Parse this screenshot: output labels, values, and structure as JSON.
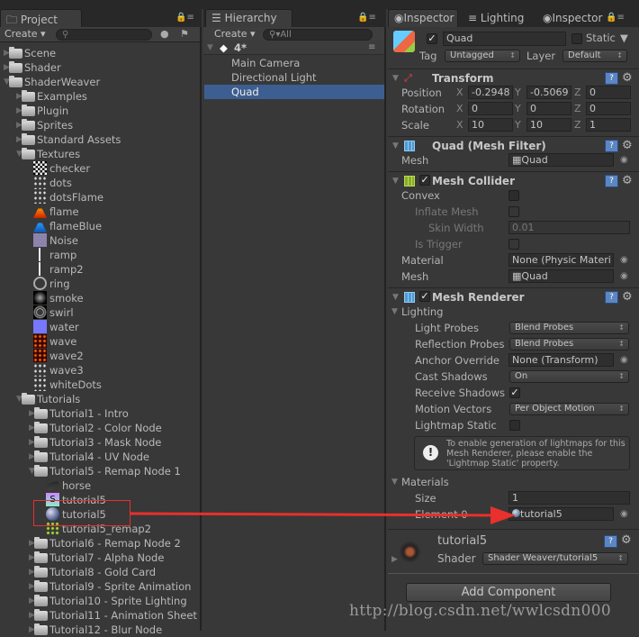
{
  "project": {
    "tab_label": "Project",
    "create_label": "Create",
    "search_placeholder": "",
    "tree": [
      {
        "label": "Scene",
        "depth": 0,
        "icon": "folder",
        "arrow": "collapsed"
      },
      {
        "label": "Shader",
        "depth": 0,
        "icon": "folder",
        "arrow": "collapsed"
      },
      {
        "label": "ShaderWeaver",
        "depth": 0,
        "icon": "folder",
        "arrow": "expanded"
      },
      {
        "label": "Examples",
        "depth": 1,
        "icon": "folder",
        "arrow": "collapsed"
      },
      {
        "label": "Plugin",
        "depth": 1,
        "icon": "folder",
        "arrow": "collapsed"
      },
      {
        "label": "Sprites",
        "depth": 1,
        "icon": "folder",
        "arrow": "collapsed"
      },
      {
        "label": "Standard Assets",
        "depth": 1,
        "icon": "folder",
        "arrow": "collapsed"
      },
      {
        "label": "Textures",
        "depth": 1,
        "icon": "folder",
        "arrow": "expanded"
      },
      {
        "label": "checker",
        "depth": 2,
        "icon": "texture-checker"
      },
      {
        "label": "dots",
        "depth": 2,
        "icon": "texture-dots"
      },
      {
        "label": "dotsFlame",
        "depth": 2,
        "icon": "texture-dots"
      },
      {
        "label": "flame",
        "depth": 2,
        "icon": "texture-flame"
      },
      {
        "label": "flameBlue",
        "depth": 2,
        "icon": "texture-flameblue"
      },
      {
        "label": "Noise",
        "depth": 2,
        "icon": "texture-noise"
      },
      {
        "label": "ramp",
        "depth": 2,
        "icon": "texture-ramp"
      },
      {
        "label": "ramp2",
        "depth": 2,
        "icon": "texture-ramp"
      },
      {
        "label": "ring",
        "depth": 2,
        "icon": "texture-ring"
      },
      {
        "label": "smoke",
        "depth": 2,
        "icon": "texture-smoke"
      },
      {
        "label": "swirl",
        "depth": 2,
        "icon": "texture-swirl"
      },
      {
        "label": "water",
        "depth": 2,
        "icon": "texture-water"
      },
      {
        "label": "wave",
        "depth": 2,
        "icon": "texture-wave"
      },
      {
        "label": "wave2",
        "depth": 2,
        "icon": "texture-wave"
      },
      {
        "label": "wave3",
        "depth": 2,
        "icon": "texture-dots"
      },
      {
        "label": "whiteDots",
        "depth": 2,
        "icon": "texture-dots"
      },
      {
        "label": "Tutorials",
        "depth": 1,
        "icon": "folder",
        "arrow": "expanded"
      },
      {
        "label": "Tutorial1 - Intro",
        "depth": 2,
        "icon": "folder",
        "arrow": "collapsed"
      },
      {
        "label": "Tutorial2 - Color Node",
        "depth": 2,
        "icon": "folder",
        "arrow": "collapsed"
      },
      {
        "label": "Tutorial3 - Mask Node",
        "depth": 2,
        "icon": "folder",
        "arrow": "collapsed"
      },
      {
        "label": "Tutorial4 - UV Node",
        "depth": 2,
        "icon": "folder",
        "arrow": "collapsed"
      },
      {
        "label": "Tutorial5 - Remap Node 1",
        "depth": 2,
        "icon": "folder",
        "arrow": "expanded"
      },
      {
        "label": "horse",
        "depth": 3,
        "icon": "texture-horse"
      },
      {
        "label": "tutorial5",
        "depth": 3,
        "icon": "shader"
      },
      {
        "label": "tutorial5",
        "depth": 3,
        "icon": "material",
        "highlighted": true
      },
      {
        "label": "tutorial5_remap2",
        "depth": 3,
        "icon": "texture-remap"
      },
      {
        "label": "Tutorial6 - Remap Node 2",
        "depth": 2,
        "icon": "folder",
        "arrow": "collapsed"
      },
      {
        "label": "Tutorial7 - Alpha Node",
        "depth": 2,
        "icon": "folder",
        "arrow": "collapsed"
      },
      {
        "label": "Tutorial8 - Gold Card",
        "depth": 2,
        "icon": "folder",
        "arrow": "collapsed"
      },
      {
        "label": "Tutorial9 - Sprite Animation",
        "depth": 2,
        "icon": "folder",
        "arrow": "collapsed"
      },
      {
        "label": "Tutorial10 - Sprite Lighting",
        "depth": 2,
        "icon": "folder",
        "arrow": "collapsed"
      },
      {
        "label": "Tutorial11 - Animation Sheet",
        "depth": 2,
        "icon": "folder",
        "arrow": "collapsed"
      },
      {
        "label": "Tutorial12 - Blur Node",
        "depth": 2,
        "icon": "folder",
        "arrow": "collapsed"
      }
    ]
  },
  "hierarchy": {
    "tab_label": "Hierarchy",
    "create_label": "Create",
    "search_placeholder": "All",
    "scene_name": "4*",
    "items": [
      {
        "label": "Main Camera",
        "selected": false
      },
      {
        "label": "Directional Light",
        "selected": false
      },
      {
        "label": "Quad",
        "selected": true
      }
    ]
  },
  "inspector": {
    "tabs": [
      "Inspector",
      "Lighting",
      "Inspector"
    ],
    "object_name": "Quad",
    "active": true,
    "static_label": "Static",
    "static": false,
    "tag_label": "Tag",
    "tag_value": "Untagged",
    "layer_label": "Layer",
    "layer_value": "Default",
    "transform": {
      "title": "Transform",
      "rows": [
        {
          "label": "Position",
          "x": "-0.2948",
          "y": "-0.5069",
          "z": "0"
        },
        {
          "label": "Rotation",
          "x": "0",
          "y": "0",
          "z": "0"
        },
        {
          "label": "Scale",
          "x": "10",
          "y": "10",
          "z": "1"
        }
      ]
    },
    "mesh_filter": {
      "title": "Quad (Mesh Filter)",
      "mesh_label": "Mesh",
      "mesh_value": "Quad"
    },
    "mesh_collider": {
      "title": "Mesh Collider",
      "enabled": true,
      "convex_label": "Convex",
      "convex": false,
      "inflate_label": "Inflate Mesh",
      "inflate": false,
      "skin_label": "Skin Width",
      "skin_value": "0.01",
      "trigger_label": "Is Trigger",
      "trigger": false,
      "material_label": "Material",
      "material_value": "None (Physic Materi",
      "mesh_label": "Mesh",
      "mesh_value": "Quad"
    },
    "mesh_renderer": {
      "title": "Mesh Renderer",
      "enabled": true,
      "lighting_label": "Lighting",
      "light_probes_label": "Light Probes",
      "light_probes": "Blend Probes",
      "reflection_label": "Reflection Probes",
      "reflection": "Blend Probes",
      "anchor_label": "Anchor Override",
      "anchor": "None (Transform)",
      "cast_label": "Cast Shadows",
      "cast": "On",
      "receive_label": "Receive Shadows",
      "receive": true,
      "motion_label": "Motion Vectors",
      "motion": "Per Object Motion",
      "lightmap_label": "Lightmap Static",
      "lightmap": false,
      "help_text": "To enable generation of lightmaps for this Mesh Renderer, please enable the 'Lightmap Static' property.",
      "materials_label": "Materials",
      "size_label": "Size",
      "size": "1",
      "element_label": "Element 0",
      "element": "tutorial5"
    },
    "material": {
      "name": "tutorial5",
      "shader_label": "Shader",
      "shader": "Shader Weaver/tutorial5"
    },
    "add_component_label": "Add Component"
  },
  "watermark": "http://blog.csdn.net/wwlcsdn000",
  "colors": {
    "selection": "#3d5e91",
    "annotation": "#e8302c"
  }
}
